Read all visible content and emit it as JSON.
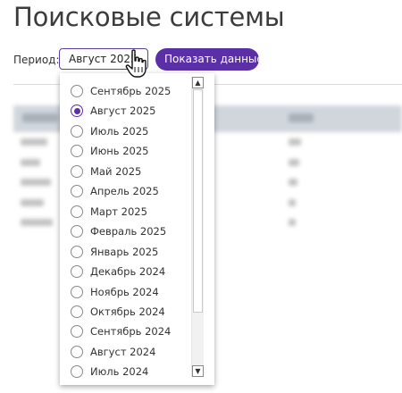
{
  "page": {
    "title": "Поисковые системы"
  },
  "controls": {
    "period_label": "Период:",
    "period_selected": "Август 2025",
    "show_button": "Показать данные"
  },
  "dropdown": {
    "selected_index": 1,
    "options": [
      "Сентябрь 2025",
      "Август 2025",
      "Июль 2025",
      "Июнь 2025",
      "Май 2025",
      "Апрель 2025",
      "Март 2025",
      "Февраль 2025",
      "Январь 2025",
      "Декабрь 2024",
      "Ноябрь 2024",
      "Октябрь 2024",
      "Сентябрь 2024",
      "Август 2024",
      "Июль 2024"
    ]
  },
  "colors": {
    "accent": "#5b2fa6"
  }
}
